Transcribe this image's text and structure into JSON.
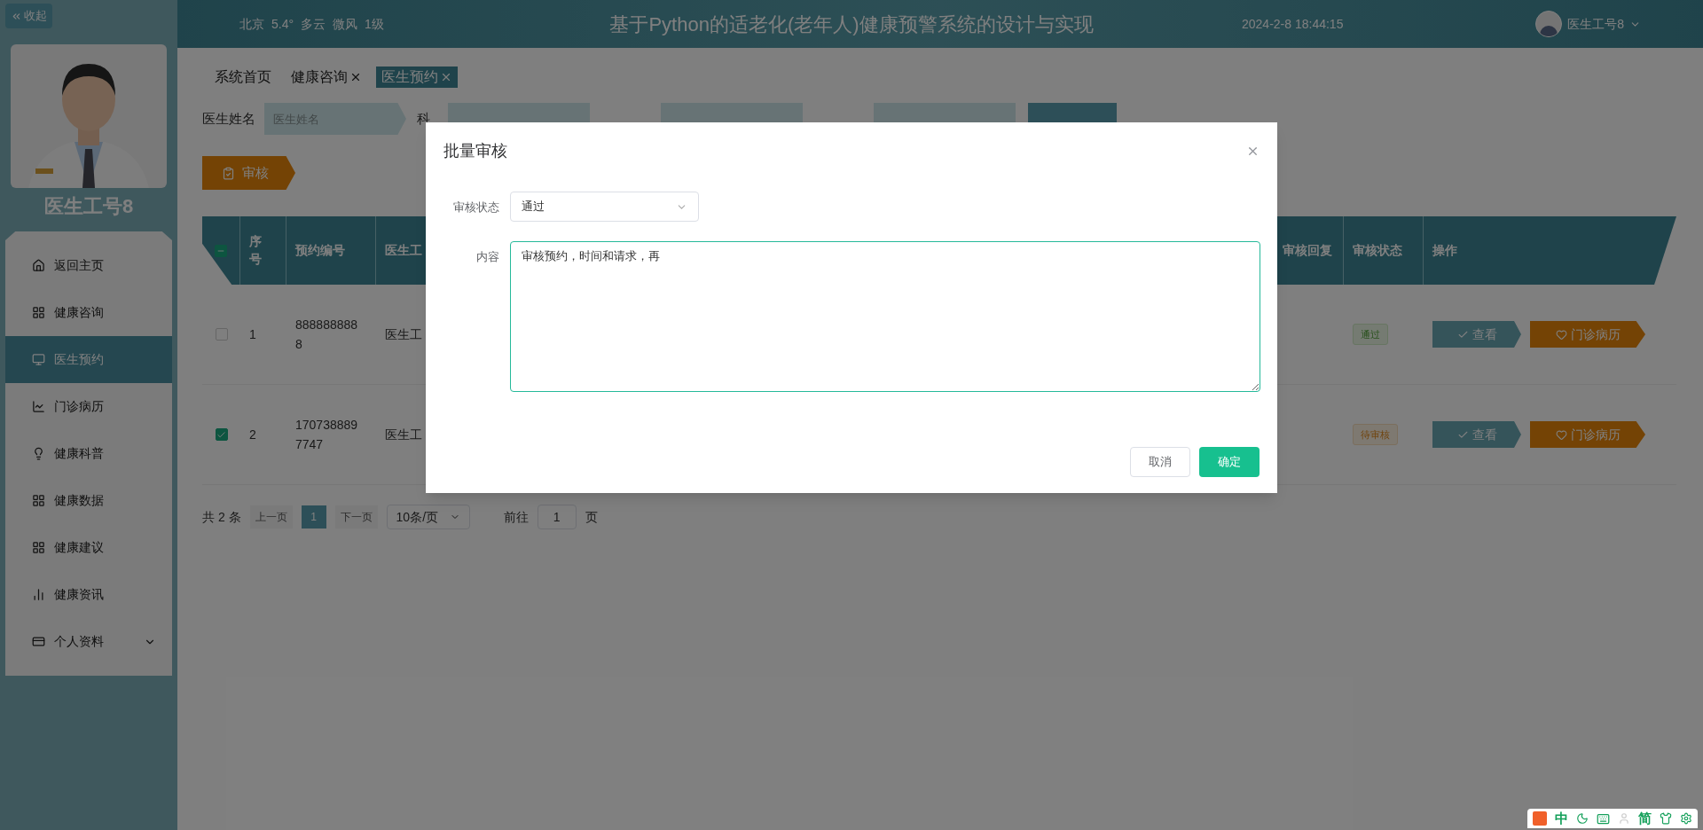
{
  "header": {
    "collapse": "收起",
    "weather": [
      "北京",
      "5.4°",
      "多云",
      "微风",
      "1级"
    ],
    "title": "基于Python的适老化(老年人)健康预警系统的设计与实现",
    "datetime": "2024-2-8 18:44:15",
    "user": "医生工号8"
  },
  "sidebar": {
    "name": "医生工号8",
    "items": [
      {
        "label": "返回主页",
        "selected": false,
        "expandable": false
      },
      {
        "label": "健康咨询",
        "selected": false,
        "expandable": false
      },
      {
        "label": "医生预约",
        "selected": true,
        "expandable": false
      },
      {
        "label": "门诊病历",
        "selected": false,
        "expandable": false
      },
      {
        "label": "健康科普",
        "selected": false,
        "expandable": false
      },
      {
        "label": "健康数据",
        "selected": false,
        "expandable": false
      },
      {
        "label": "健康建议",
        "selected": false,
        "expandable": false
      },
      {
        "label": "健康资讯",
        "selected": false,
        "expandable": false
      },
      {
        "label": "个人资料",
        "selected": false,
        "expandable": true
      }
    ]
  },
  "tabs": [
    {
      "label": "系统首页",
      "closable": false,
      "selected": false
    },
    {
      "label": "健康咨询",
      "closable": true,
      "selected": false
    },
    {
      "label": "医生预约",
      "closable": true,
      "selected": true
    }
  ],
  "search": {
    "label": "医生姓名",
    "placeholder": "医生姓名",
    "label_2": "科"
  },
  "audit_button": "审核",
  "table": {
    "header_checkbox": {
      "indeterminate": true
    },
    "columns": [
      "序号",
      "预约编号",
      "医生工",
      "审核回复",
      "审核状态",
      "操作"
    ],
    "rows": [
      {
        "checked": false,
        "index": "1",
        "number": "8888888888",
        "doctor": "医生工",
        "status": {
          "label": "通过",
          "kind": "approved"
        },
        "actions": [
          "查看",
          "门诊病历"
        ]
      },
      {
        "checked": true,
        "index": "2",
        "number": "1707388897747",
        "doctor": "医生工",
        "status": {
          "label": "待审核",
          "kind": "pending"
        },
        "actions": [
          "查看",
          "门诊病历"
        ]
      }
    ]
  },
  "pagination": {
    "total": "共 2 条",
    "prev": "上一页",
    "pages": [
      {
        "label": "1",
        "selected": true
      }
    ],
    "next": "下一页",
    "page_size": "10条/页",
    "goto": "前往",
    "goto_value": "1",
    "unit": "页"
  },
  "modal": {
    "title": "批量审核",
    "fields": [
      {
        "kind": "select",
        "label": "审核状态",
        "value": "通过"
      },
      {
        "kind": "textarea",
        "label": "内容",
        "value": "审核预约，时间和请求，再"
      }
    ],
    "buttons": [
      {
        "label": "取消",
        "kind": "secondary"
      },
      {
        "label": "确定",
        "kind": "primary"
      }
    ]
  },
  "ime": {
    "mode": "中",
    "script": "简"
  }
}
